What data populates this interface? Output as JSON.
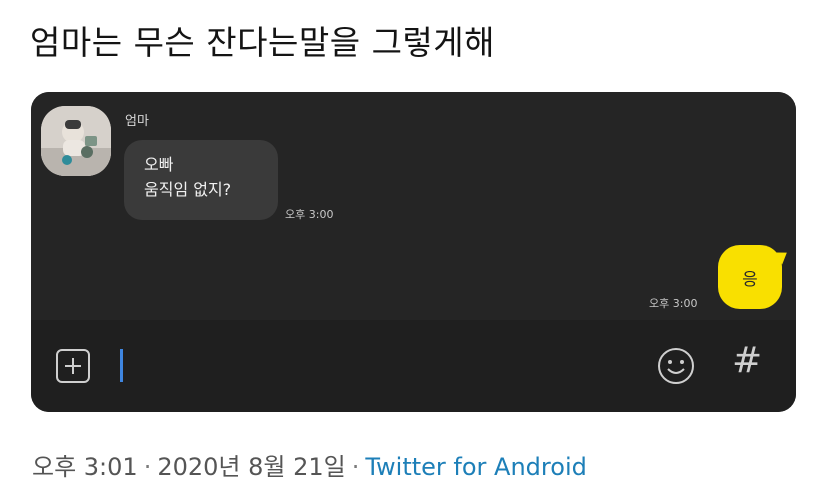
{
  "tweet": {
    "text": "엄마는 무슨 잔다는말을 그렇게해"
  },
  "chat": {
    "sender_name": "엄마",
    "incoming_message": {
      "lines": [
        "오빠",
        "움직임 없지?"
      ],
      "time": "오후 3:00"
    },
    "outgoing_message": {
      "text": "응",
      "time": "오후 3:00"
    },
    "input_bar": {
      "add_icon": "plus-square-icon",
      "emoji_icon": "smiley-icon",
      "hash_label": "#"
    },
    "colors": {
      "background": "#252525",
      "input_bar": "#1f1f1f",
      "incoming_bubble": "#3a3a3a",
      "outgoing_bubble": "#f9e000",
      "caret": "#3f86e0"
    }
  },
  "meta": {
    "time": "오후 3:01",
    "date": "2020년 8월 21일",
    "separator": "·",
    "source": "Twitter for Android",
    "source_color": "#1d7fb8"
  }
}
